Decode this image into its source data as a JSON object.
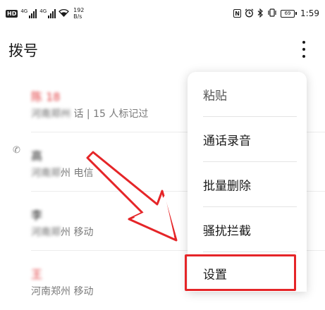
{
  "status_bar": {
    "hd_badge": "HD",
    "sim1_tag": "4G",
    "sim2_tag": "4G",
    "wifi_icon": "wifi-icon",
    "net_speed_value": "192",
    "net_speed_unit": "B/s",
    "nfc_icon": "N",
    "alarm_icon": "alarm-icon",
    "bluetooth_icon": "bluetooth-icon",
    "vibrate_icon": "vibrate-icon",
    "battery_level_text": "69",
    "time": "1:59"
  },
  "header": {
    "title": "拨号",
    "more_icon": "more-vert-icon"
  },
  "call_log": [
    {
      "name_visible": "陈 18",
      "name_color": "#e0383b",
      "call_type_icon": "",
      "sub_masked": "河南郑州 ",
      "sub_clear": "话 | 15 人标记过"
    },
    {
      "name_visible": "高",
      "name_color": "#1a1a1a",
      "call_type_icon": "✆",
      "sub_masked": "河南郑",
      "sub_clear": "州 电信"
    },
    {
      "name_visible": "李",
      "name_color": "#1a1a1a",
      "call_type_icon": "",
      "sub_masked": "河南郑",
      "sub_clear": "州 移动"
    },
    {
      "name_visible": "王",
      "name_color": "#e0383b",
      "call_type_icon": "",
      "sub_masked": "",
      "sub_clear": "河南郑州 移动"
    }
  ],
  "menu": {
    "items": [
      {
        "label": "粘贴"
      },
      {
        "label": "通话录音"
      },
      {
        "label": "批量删除"
      },
      {
        "label": "骚扰拦截"
      },
      {
        "label": "设置"
      }
    ],
    "highlighted_index": 4
  },
  "annotation": {
    "arrow_color": "#e52528",
    "box_color": "#e52528"
  }
}
